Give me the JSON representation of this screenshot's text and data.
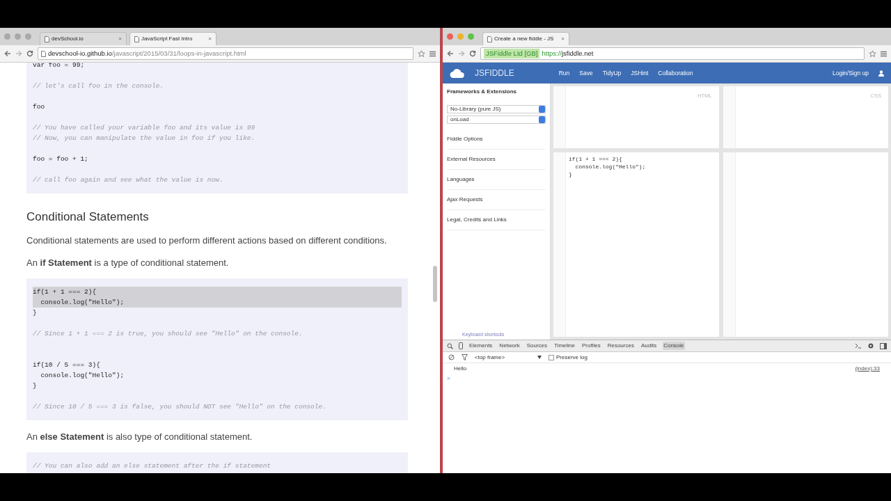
{
  "left_window": {
    "tabs": [
      {
        "label": "devSchool.io",
        "selected": false,
        "close": "×"
      },
      {
        "label": "JavaScript Fast Intro",
        "selected": true,
        "close": "×"
      }
    ],
    "address": {
      "host": "devschool-io.github.io",
      "path": "/javascript/2015/03/31/loops-in-javascript.html"
    },
    "content": [
      {
        "kind": "code",
        "lines": [
          {
            "kind": "code",
            "text": "var foo = 99;"
          },
          {
            "kind": "blank"
          },
          {
            "kind": "comment",
            "text": "// let's call foo in the console."
          },
          {
            "kind": "blank"
          },
          {
            "kind": "code",
            "text": "foo"
          },
          {
            "kind": "blank"
          },
          {
            "kind": "comment",
            "text": "// You have called your variable foo and its value is 99"
          },
          {
            "kind": "comment",
            "text": "// Now, you can manipulate the value in foo if you like."
          },
          {
            "kind": "blank"
          },
          {
            "kind": "code",
            "text": "foo = foo + 1;"
          },
          {
            "kind": "blank"
          },
          {
            "kind": "comment",
            "text": "// call foo again and see what the value is now."
          }
        ]
      },
      {
        "kind": "heading",
        "text": "Conditional Statements"
      },
      {
        "kind": "paragraph",
        "text": "Conditional statements are used to perform different actions based on different conditions."
      },
      {
        "kind": "paragraph",
        "text": "An **if Statement** is a type of conditional statement."
      },
      {
        "kind": "code",
        "lines": [
          {
            "kind": "code",
            "text": "if(1 + 1 === 2){",
            "highlighted": true
          },
          {
            "kind": "code",
            "text": "  console.log(\"Hello\");",
            "highlighted": true
          },
          {
            "kind": "code",
            "text": "}",
            "highlighted": false
          },
          {
            "kind": "blank"
          },
          {
            "kind": "comment",
            "text": "// Since 1 + 1 === 2 is true, you should see \"Hello\" on the console.",
            "highlighted": false
          },
          {
            "kind": "blank"
          },
          {
            "kind": "blank"
          },
          {
            "kind": "code",
            "text": "if(10 / 5 === 3){",
            "highlighted": false
          },
          {
            "kind": "code",
            "text": "  console.log(\"Hello\");",
            "highlighted": false
          },
          {
            "kind": "code",
            "text": "}",
            "highlighted": false
          },
          {
            "kind": "blank"
          },
          {
            "kind": "comment",
            "text": "// Since 10 / 5 === 3 is false, you should NOT see \"Hello\" on the console.",
            "highlighted": false
          }
        ]
      },
      {
        "kind": "paragraph",
        "text": "An **else Statement** is also type of conditional statement."
      },
      {
        "kind": "code",
        "lines": [
          {
            "kind": "comment",
            "text": "// You can also add an else statement after the if statement"
          }
        ]
      }
    ]
  },
  "right_window": {
    "tabs": [
      {
        "label": "Create a new fiddle - JS",
        "selected": true,
        "close": "×"
      }
    ],
    "address": {
      "identity": "JSFiddle Ltd [GB]",
      "scheme": "https://",
      "host": "jsfiddle.net"
    },
    "navbar": {
      "brand": "JSFIDDLE",
      "actions": [
        "Run",
        "Save",
        "TidyUp",
        "JSHint",
        "Collaboration"
      ],
      "login": "Login/Sign up"
    },
    "sidebar": {
      "title": "Frameworks & Extensions",
      "selects": [
        "No-Library (pure JS)",
        "onLoad"
      ],
      "items": [
        "Fiddle Options",
        "External Resources",
        "Languages",
        "Ajax Requests",
        "Legal, Credits and Links"
      ],
      "footer": "Keyboard shortcuts"
    },
    "panels": {
      "html_label": "HTML",
      "css_label": "CSS",
      "js_lines": [
        "if(1 + 1 === 2){",
        "  console.log(\"Hello\");",
        "}"
      ]
    },
    "devtools": {
      "tabs": [
        {
          "label": "Elements",
          "selected": false
        },
        {
          "label": "Network",
          "selected": false
        },
        {
          "label": "Sources",
          "selected": false
        },
        {
          "label": "Timeline",
          "selected": false
        },
        {
          "label": "Profiles",
          "selected": false
        },
        {
          "label": "Resources",
          "selected": false
        },
        {
          "label": "Audits",
          "selected": false
        },
        {
          "label": "Console",
          "selected": true
        }
      ],
      "frame": "<top frame>",
      "preserve_log": {
        "label": "Preserve log",
        "checked": false
      },
      "messages": [
        {
          "text": "Hello",
          "source": "(index):33"
        }
      ],
      "prompt": ">"
    }
  }
}
